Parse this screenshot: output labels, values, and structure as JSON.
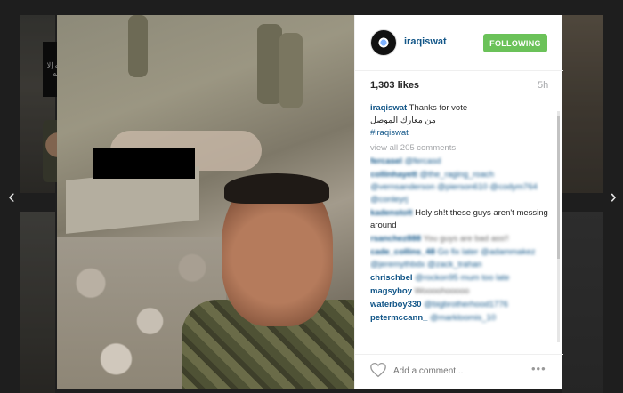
{
  "background": {
    "thumb_flag_text": "لا إله إلا الله",
    "nav_left": "‹",
    "nav_right": "›"
  },
  "post": {
    "username": "iraqiswat",
    "follow_label": "FOLLOWING",
    "likes": "1,303 likes",
    "time": "5h",
    "caption_user": "iraqiswat",
    "caption_text": "Thanks for vote",
    "caption_arabic": "من معارك الموصل",
    "caption_tag": "#iraqiswat",
    "view_all": "view all 205 comments",
    "comments": [
      {
        "user": "fercasel",
        "text": "@fercasd",
        "blurred": true
      },
      {
        "user": "collinhayett",
        "text": "@the_raging_roach @vernsanderson @pierson610 @codym764 @conleyrj",
        "blurred": true
      },
      {
        "user": "kadenstolt",
        "text": "Holy sh!t these guys aren't messing around",
        "blurred_user": true
      },
      {
        "user": "rsanchez888",
        "text": "You guys are bad ass!!",
        "blurred": true
      },
      {
        "user": "cade_collins_48",
        "text": "Go fix later @adammakez @jeremythbdx @zack_trahan",
        "blurred": true
      },
      {
        "user": "chrischbel",
        "text": "@rockon95 mum too late",
        "blurred": true
      },
      {
        "user": "magsyboy",
        "text": "Woooohooooo",
        "blurred": true
      },
      {
        "user": "waterboy330",
        "text": "@bigbrotherhood1776",
        "partial_blur": true
      },
      {
        "user": "petermccann_",
        "text": "@markloomis_10",
        "partial_blur": true
      }
    ],
    "add_comment_placeholder": "Add a comment...",
    "more_label": "•••"
  }
}
